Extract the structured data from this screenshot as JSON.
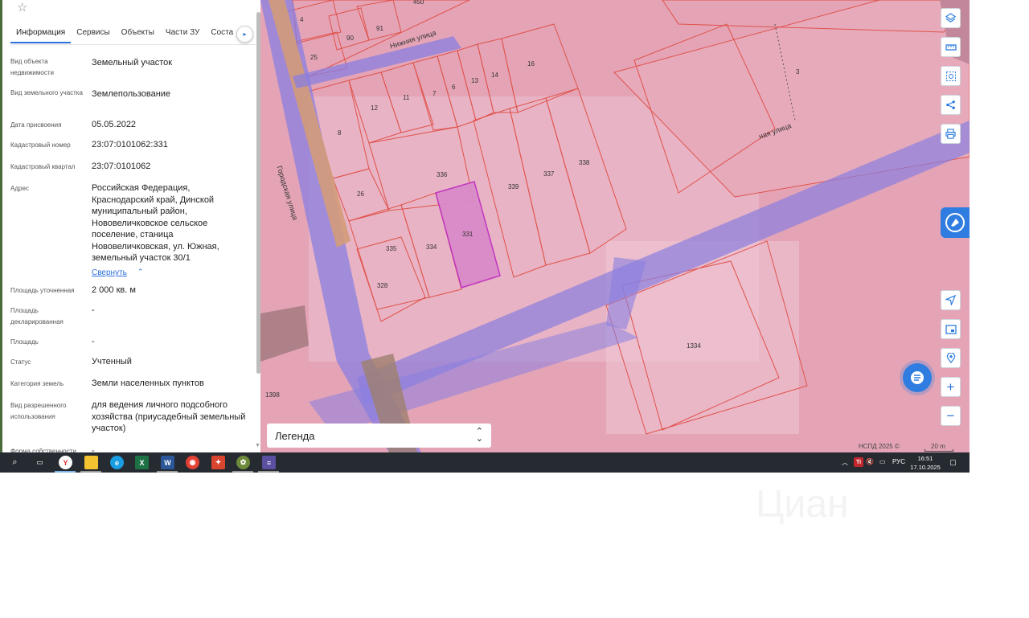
{
  "tabs": [
    "Информация",
    "Сервисы",
    "Объекты",
    "Части ЗУ",
    "Соста"
  ],
  "tab_active": 0,
  "details": [
    {
      "label": "Вид объекта недвижимости",
      "value": "Земельный участок"
    },
    {
      "label": "Вид земельного участка",
      "value": "Землепользование"
    },
    {
      "label": "Дата присвоения",
      "value": "05.05.2022"
    },
    {
      "label": "Кадастровый номер",
      "value": "23:07:0101062:331"
    },
    {
      "label": "Кадастровый квартал",
      "value": "23:07:0101062"
    },
    {
      "label": "Адрес",
      "value": "Российская Федерация, Краснодарский край, Динской муниципальный район, Нововеличковское сельское поселение, станица Нововеличковская, ул. Южная, земельный участок 30/1"
    },
    {
      "label": "Площадь уточненная",
      "value": "2 000 кв. м"
    },
    {
      "label": "Площадь декларированная",
      "value": "-"
    },
    {
      "label": "Площадь",
      "value": "-"
    },
    {
      "label": "Статус",
      "value": "Учтенный"
    },
    {
      "label": "Категория земель",
      "value": "Земли населенных пунктов"
    },
    {
      "label": "Вид разрешенного использования",
      "value": "для ведения личного подсобного хозяйства (приусадебный земельный участок)"
    },
    {
      "label": "Форма собственности",
      "value": "-"
    }
  ],
  "collapse_link": "Свернуть",
  "map": {
    "streets": [
      "Нижняя улица",
      "Городская улица",
      "ная улица"
    ],
    "parcels": [
      "450",
      "4",
      "91",
      "90",
      "25",
      "16",
      "14",
      "13",
      "6",
      "7",
      "11",
      "12",
      "8",
      "3",
      "336",
      "339",
      "337",
      "338",
      "26",
      "331",
      "335",
      "334",
      "328",
      "1334",
      "1398"
    ]
  },
  "legend_label": "Легенда",
  "copyright": "НСПД 2025 ©",
  "scale_label": "20 m",
  "taskbar": {
    "lang": "РУС",
    "time": "16:51",
    "date": "17.10.2025"
  },
  "watermark": "Циан",
  "colors": {
    "accent": "#2f7de1",
    "selected_parcel": "#c030c0",
    "parcel_border": "#e0524a"
  }
}
